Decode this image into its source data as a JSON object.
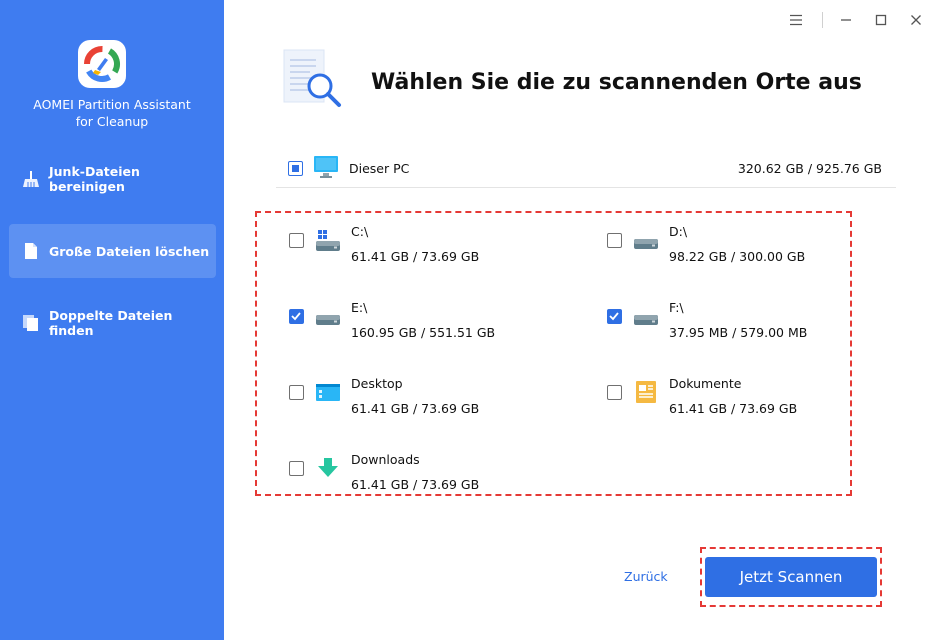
{
  "app": {
    "title_line1": "AOMEI Partition Assistant",
    "title_line2": "for Cleanup"
  },
  "sidebar": {
    "items": [
      {
        "label": "Junk-Dateien bereinigen",
        "icon": "broom-icon",
        "active": false
      },
      {
        "label": "Große Dateien löschen",
        "icon": "large-file-icon",
        "active": true
      },
      {
        "label": "Doppelte Dateien finden",
        "icon": "duplicate-files-icon",
        "active": false
      }
    ]
  },
  "window_controls": [
    "menu-icon",
    "minimize-icon",
    "maximize-icon",
    "close-icon"
  ],
  "header": {
    "title": "Wählen Sie die zu scannenden Orte aus"
  },
  "pc": {
    "name": "Dieser PC",
    "size": "320.62 GB / 925.76 GB",
    "check_state": "partial"
  },
  "locations": [
    {
      "name": "C:\\",
      "size": "61.41 GB / 73.69 GB",
      "checked": false,
      "icon": "windows-drive-icon"
    },
    {
      "name": "D:\\",
      "size": "98.22 GB / 300.00 GB",
      "checked": false,
      "icon": "drive-icon"
    },
    {
      "name": "E:\\",
      "size": "160.95 GB / 551.51 GB",
      "checked": true,
      "icon": "drive-icon"
    },
    {
      "name": "F:\\",
      "size": "37.95 MB / 579.00 MB",
      "checked": true,
      "icon": "drive-icon"
    },
    {
      "name": "Desktop",
      "size": "61.41 GB / 73.69 GB",
      "checked": false,
      "icon": "desktop-icon"
    },
    {
      "name": "Dokumente",
      "size": "61.41 GB / 73.69 GB",
      "checked": false,
      "icon": "documents-icon"
    },
    {
      "name": "Downloads",
      "size": "61.41 GB / 73.69 GB",
      "checked": false,
      "icon": "downloads-icon"
    }
  ],
  "footer": {
    "back_label": "Zurück",
    "scan_label": "Jetzt Scannen"
  },
  "colors": {
    "sidebar": "#3f7cf0",
    "accent": "#2f6fe4",
    "highlight": "#e53935"
  }
}
